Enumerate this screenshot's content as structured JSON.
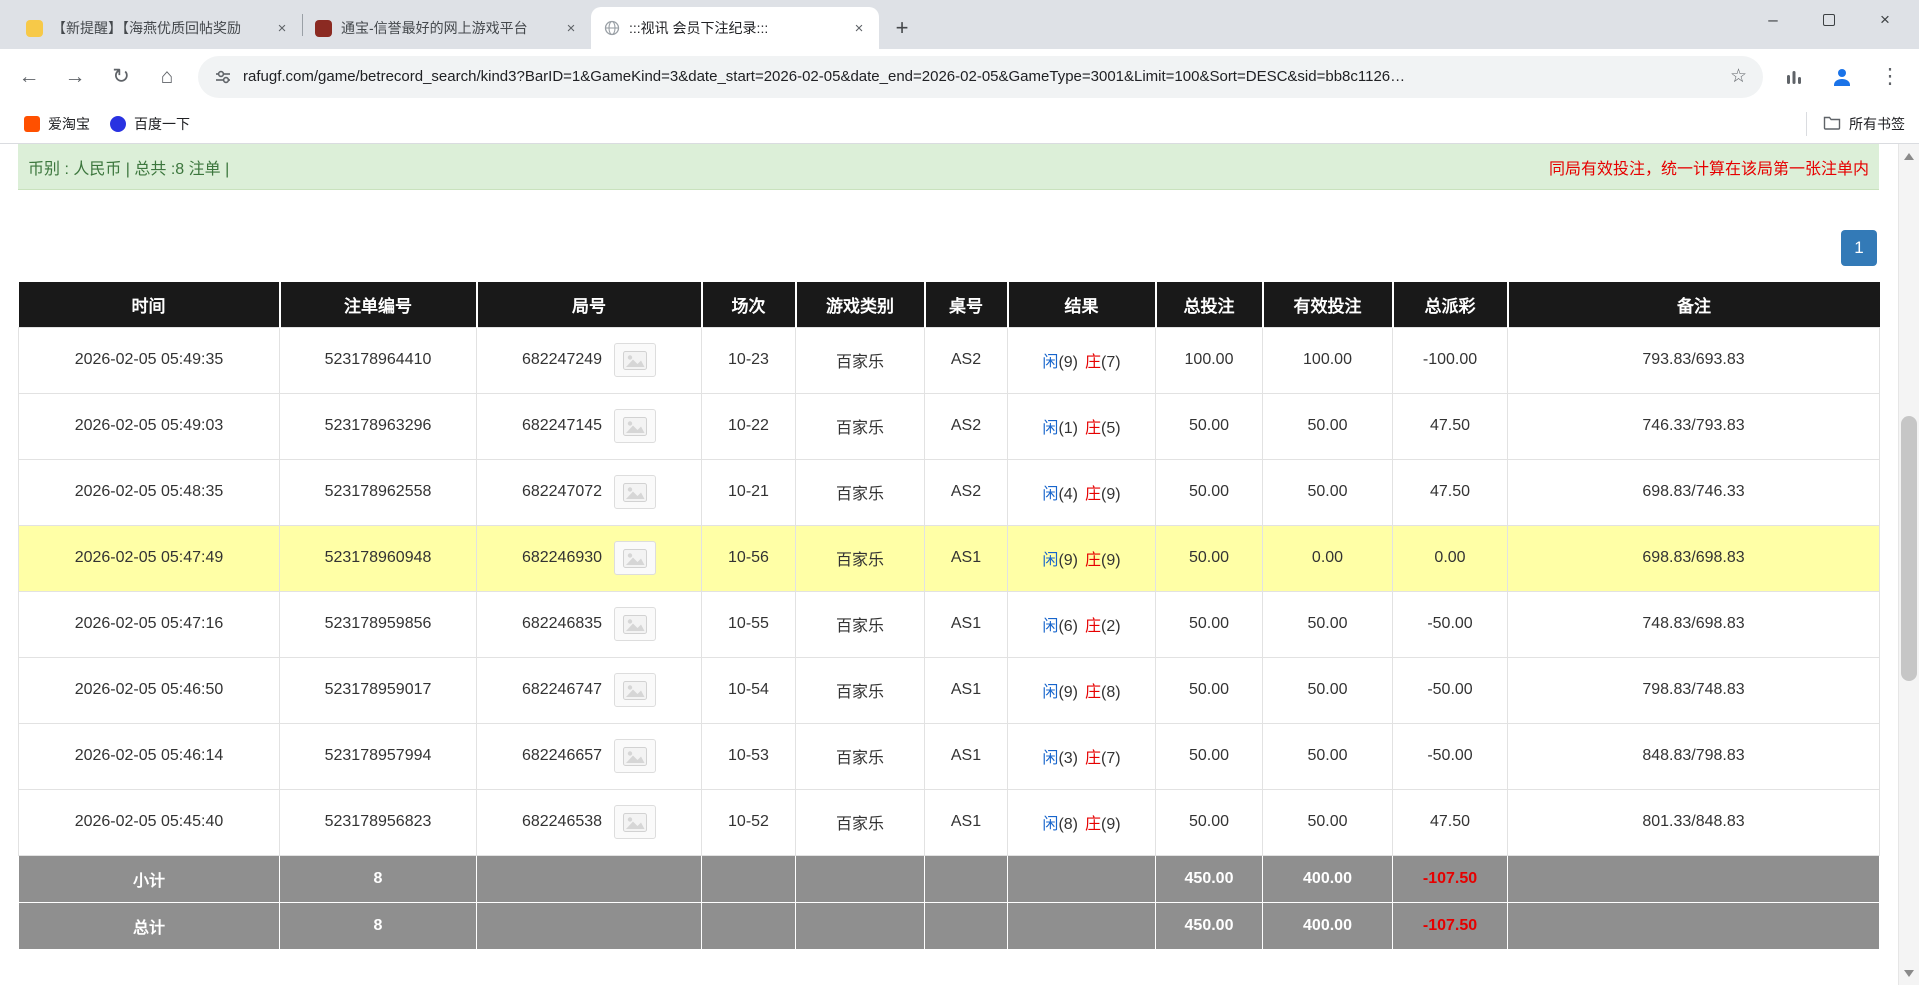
{
  "icons": {
    "back": "←",
    "forward": "→",
    "reload": "↻",
    "home": "⌂",
    "star": "☆",
    "menu": "⋮",
    "minimize": "–",
    "close": "×",
    "new_tab": "+",
    "tab_close": "×",
    "round_media": "video-icon"
  },
  "window": {
    "tabs": [
      {
        "title": "【新提醒】【海燕优质回帖奖励"
      },
      {
        "title": "通宝-信誉最好的网上游戏平台"
      },
      {
        "title": ":::视讯 会员下注纪录:::"
      }
    ]
  },
  "toolbar": {
    "url": "rafugf.com/game/betrecord_search/kind3?BarID=1&GameKind=3&date_start=2026-02-05&date_end=2026-02-05&GameType=3001&Limit=100&Sort=DESC&sid=bb8c1126…"
  },
  "bookmarks_bar": {
    "items": [
      {
        "label": "爱淘宝"
      },
      {
        "label": "百度一下"
      }
    ],
    "all_bookmarks_label": "所有书签"
  },
  "page": {
    "currency_bar": {
      "left": "币别 : 人民币 | 总共 :8 注单 |",
      "right": "同局有效投注，统一计算在该局第一张注单内"
    },
    "pagination": {
      "pages": [
        "1"
      ]
    },
    "table": {
      "headers": [
        "时间",
        "注单编号",
        "局号",
        "场次",
        "游戏类别",
        "桌号",
        "结果",
        "总投注",
        "有效投注",
        "总派彩",
        "备注"
      ],
      "rows": [
        {
          "time": "2026-02-05 05:49:35",
          "bet_no": "523178964410",
          "round_no": "682247249",
          "session": "10-23",
          "game": "百家乐",
          "table_no": "AS2",
          "player_label": "闲",
          "player_score": "(9)",
          "banker_label": "庄",
          "banker_score": "(7)",
          "total_bet": "100.00",
          "valid_bet": "100.00",
          "payout": "-100.00",
          "note": "793.83/693.83",
          "highlight": false
        },
        {
          "time": "2026-02-05 05:49:03",
          "bet_no": "523178963296",
          "round_no": "682247145",
          "session": "10-22",
          "game": "百家乐",
          "table_no": "AS2",
          "player_label": "闲",
          "player_score": "(1)",
          "banker_label": "庄",
          "banker_score": "(5)",
          "total_bet": "50.00",
          "valid_bet": "50.00",
          "payout": "47.50",
          "note": "746.33/793.83",
          "highlight": false
        },
        {
          "time": "2026-02-05 05:48:35",
          "bet_no": "523178962558",
          "round_no": "682247072",
          "session": "10-21",
          "game": "百家乐",
          "table_no": "AS2",
          "player_label": "闲",
          "player_score": "(4)",
          "banker_label": "庄",
          "banker_score": "(9)",
          "total_bet": "50.00",
          "valid_bet": "50.00",
          "payout": "47.50",
          "note": "698.83/746.33",
          "highlight": false
        },
        {
          "time": "2026-02-05 05:47:49",
          "bet_no": "523178960948",
          "round_no": "682246930",
          "session": "10-56",
          "game": "百家乐",
          "table_no": "AS1",
          "player_label": "闲",
          "player_score": "(9)",
          "banker_label": "庄",
          "banker_score": "(9)",
          "total_bet": "50.00",
          "valid_bet": "0.00",
          "payout": "0.00",
          "note": "698.83/698.83",
          "highlight": true
        },
        {
          "time": "2026-02-05 05:47:16",
          "bet_no": "523178959856",
          "round_no": "682246835",
          "session": "10-55",
          "game": "百家乐",
          "table_no": "AS1",
          "player_label": "闲",
          "player_score": "(6)",
          "banker_label": "庄",
          "banker_score": "(2)",
          "total_bet": "50.00",
          "valid_bet": "50.00",
          "payout": "-50.00",
          "note": "748.83/698.83",
          "highlight": false
        },
        {
          "time": "2026-02-05 05:46:50",
          "bet_no": "523178959017",
          "round_no": "682246747",
          "session": "10-54",
          "game": "百家乐",
          "table_no": "AS1",
          "player_label": "闲",
          "player_score": "(9)",
          "banker_label": "庄",
          "banker_score": "(8)",
          "total_bet": "50.00",
          "valid_bet": "50.00",
          "payout": "-50.00",
          "note": "798.83/748.83",
          "highlight": false
        },
        {
          "time": "2026-02-05 05:46:14",
          "bet_no": "523178957994",
          "round_no": "682246657",
          "session": "10-53",
          "game": "百家乐",
          "table_no": "AS1",
          "player_label": "闲",
          "player_score": "(3)",
          "banker_label": "庄",
          "banker_score": "(7)",
          "total_bet": "50.00",
          "valid_bet": "50.00",
          "payout": "-50.00",
          "note": "848.83/798.83",
          "highlight": false
        },
        {
          "time": "2026-02-05 05:45:40",
          "bet_no": "523178956823",
          "round_no": "682246538",
          "session": "10-52",
          "game": "百家乐",
          "table_no": "AS1",
          "player_label": "闲",
          "player_score": "(8)",
          "banker_label": "庄",
          "banker_score": "(9)",
          "total_bet": "50.00",
          "valid_bet": "50.00",
          "payout": "47.50",
          "note": "801.33/848.83",
          "highlight": false
        }
      ],
      "summary_rows": [
        {
          "label": "小计",
          "count": "8",
          "total_bet": "450.00",
          "valid_bet": "400.00",
          "payout": "-107.50"
        },
        {
          "label": "总计",
          "count": "8",
          "total_bet": "450.00",
          "valid_bet": "400.00",
          "payout": "-107.50"
        }
      ]
    }
  },
  "colors": {
    "accent_blue": "#1765cc",
    "negative_red": "#e60000",
    "highlight_yellow": "#ffffa6",
    "header_black": "#191919",
    "summary_gray": "#8f8f8f",
    "success_green_bg": "#dcefd8",
    "success_green_text": "#3c763d",
    "pagination_blue": "#337ab7"
  }
}
